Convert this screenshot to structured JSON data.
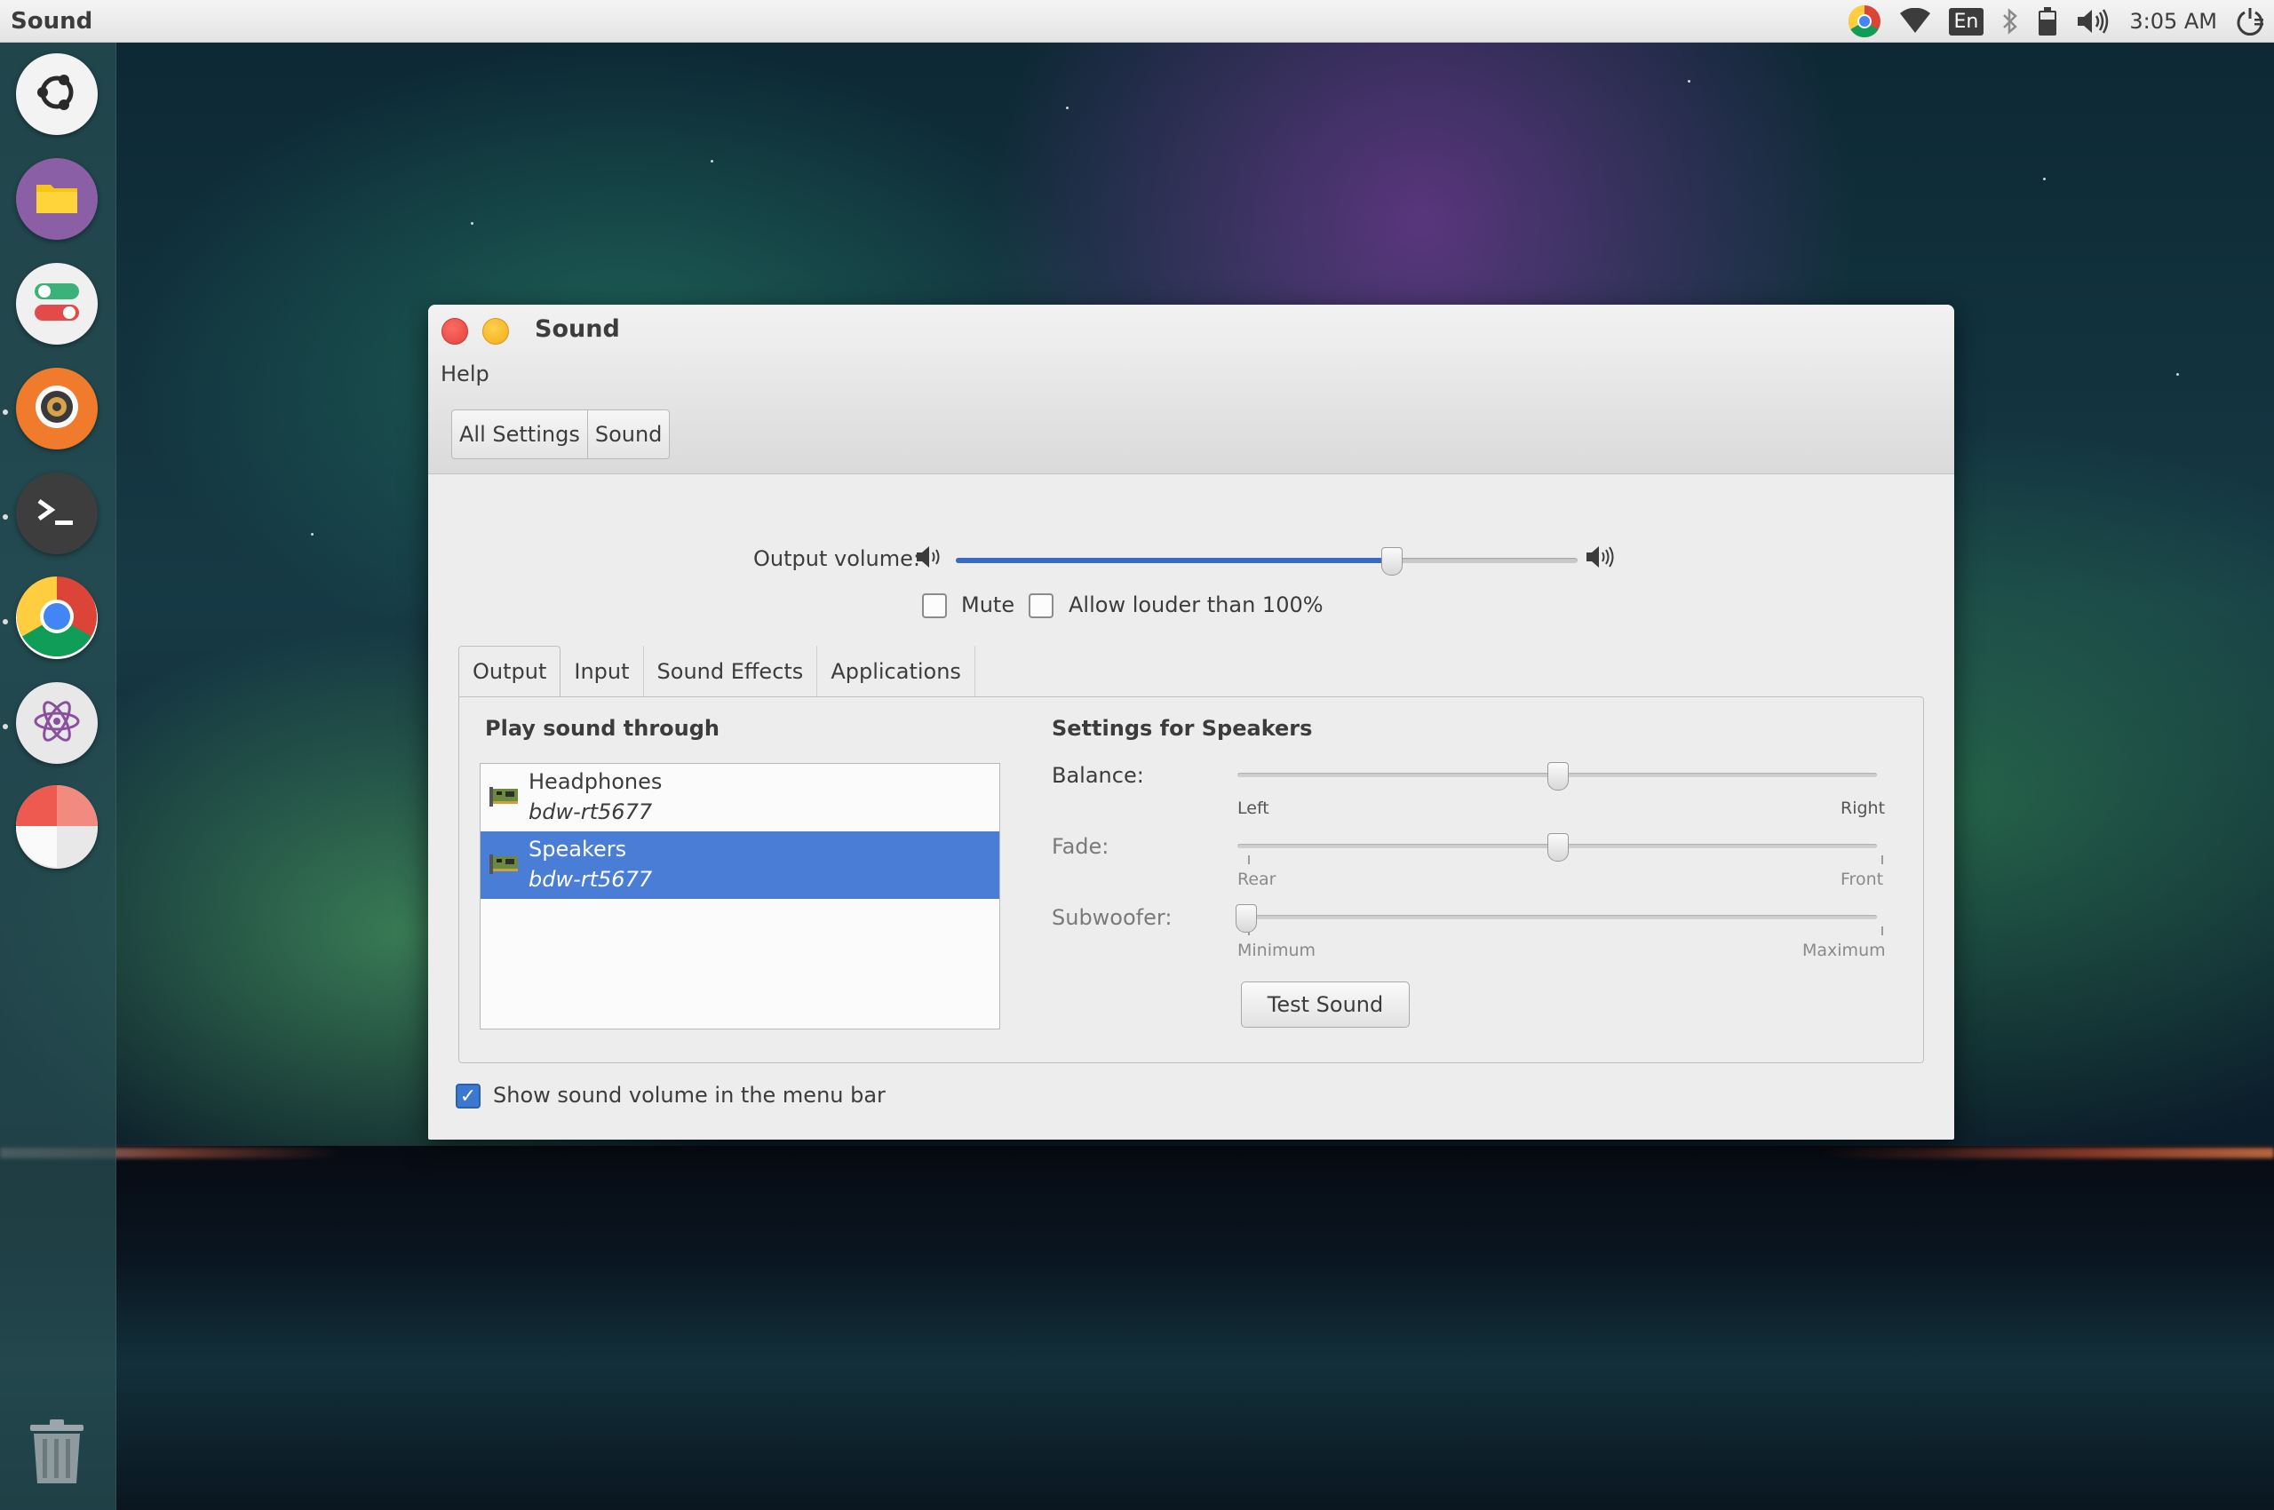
{
  "top_panel": {
    "title": "Sound",
    "keyboard_layout": "En",
    "clock": "3:05 AM",
    "tray_icons": [
      "chrome-icon",
      "wifi-icon",
      "keyboard-layout",
      "bluetooth-icon",
      "battery-icon",
      "volume-icon",
      "power-icon"
    ]
  },
  "launcher": {
    "items": [
      {
        "name": "ubuntu-dash",
        "icon": "ubuntu-logo-icon",
        "color": "#f6f6f6"
      },
      {
        "name": "files",
        "icon": "folder-icon",
        "color": "#8b5fa6"
      },
      {
        "name": "settings",
        "icon": "toggle-icon",
        "color": "#f0f0f0"
      },
      {
        "name": "sound-settings",
        "icon": "speaker-icon",
        "color": "#f07b2c"
      },
      {
        "name": "terminal",
        "icon": "terminal-icon",
        "color": "#3d3d3d"
      },
      {
        "name": "chrome",
        "icon": "chrome-icon",
        "color": "#ffffff"
      },
      {
        "name": "atom",
        "icon": "atom-icon",
        "color": "#e8e8e8"
      },
      {
        "name": "pie-app",
        "icon": "pie-chart-icon",
        "color": "#e9e9e9"
      }
    ],
    "trash_icon": "trash-icon"
  },
  "window": {
    "title": "Sound",
    "menu": [
      "Help"
    ],
    "breadcrumb": [
      "All Settings",
      "Sound"
    ],
    "output_volume_label": "Output volume:",
    "output_volume_level": 0.7,
    "mute_label": "Mute",
    "mute_checked": false,
    "louder_label": "Allow louder than 100%",
    "louder_checked": false,
    "tabs": [
      "Output",
      "Input",
      "Sound Effects",
      "Applications"
    ],
    "active_tab": "Output",
    "play_through_heading": "Play sound through",
    "devices": [
      {
        "name": "Headphones",
        "desc": "bdw-rt5677",
        "selected": false
      },
      {
        "name": "Speakers",
        "desc": "bdw-rt5677",
        "selected": true
      }
    ],
    "settings_heading": "Settings for Speakers",
    "balance": {
      "label": "Balance:",
      "left": "Left",
      "right": "Right",
      "value": 0.5
    },
    "fade": {
      "label": "Fade:",
      "left": "Rear",
      "right": "Front",
      "value": 0.5
    },
    "subwoofer": {
      "label": "Subwoofer:",
      "left": "Minimum",
      "right": "Maximum",
      "value": 0.0
    },
    "test_sound_label": "Test Sound",
    "show_volume_label": "Show sound volume in the menu bar",
    "show_volume_checked": true
  },
  "colors": {
    "accent": "#3b79d0",
    "selection": "#4a7ed6",
    "close": "#e0443b",
    "minimize": "#f2ac1a"
  }
}
